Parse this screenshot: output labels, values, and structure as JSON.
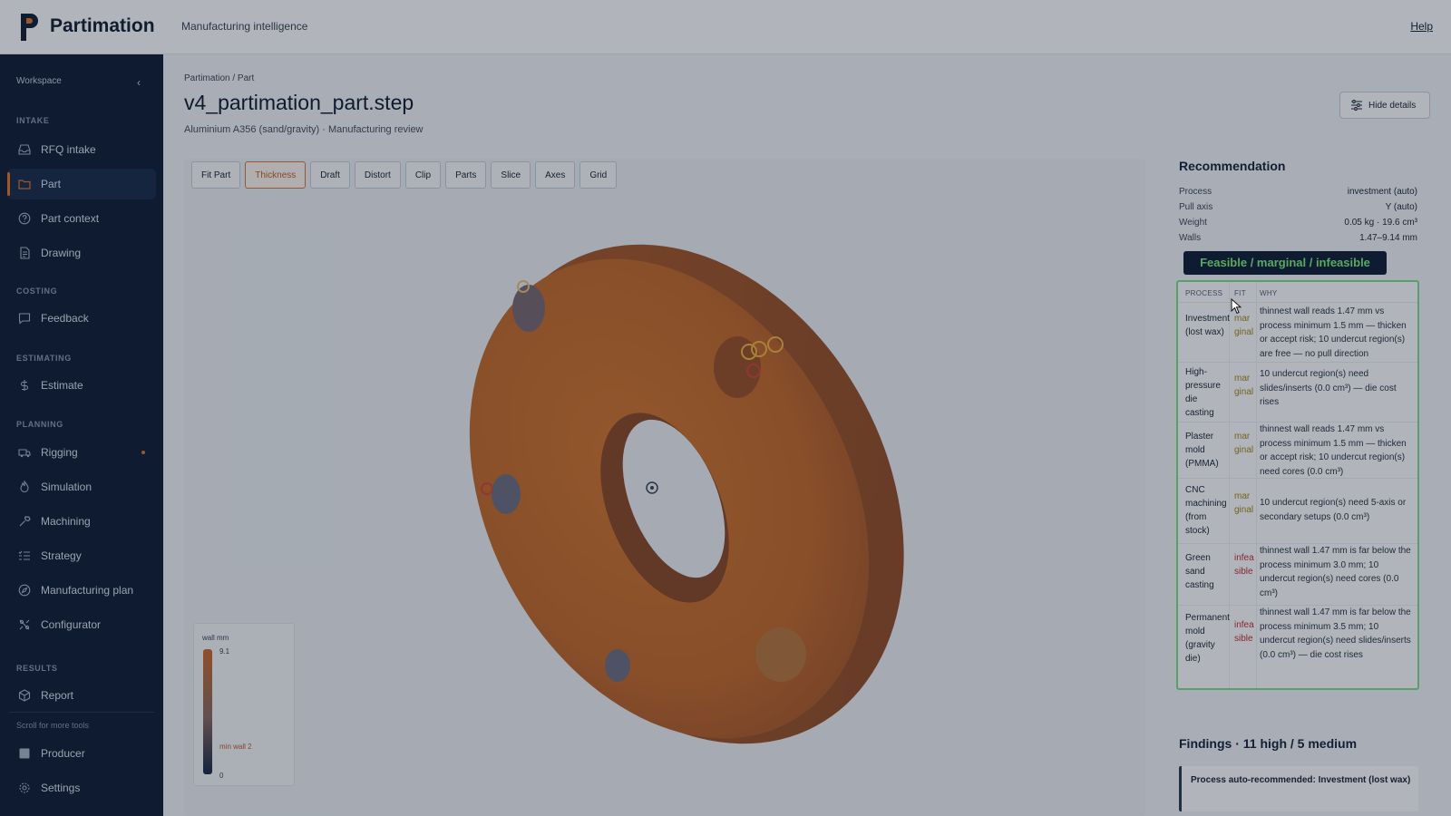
{
  "app": {
    "brand": "Partimation",
    "tagline": "Manufacturing intelligence",
    "help_label": "Help"
  },
  "sidebar": {
    "workspace_label": "Workspace",
    "sections": [
      {
        "label": "INTAKE"
      },
      {
        "label": "COSTING"
      },
      {
        "label": "ESTIMATING"
      },
      {
        "label": "PLANNING"
      },
      {
        "label": "RESULTS"
      }
    ],
    "items": [
      {
        "label": "RFQ intake",
        "icon": "inbox-icon"
      },
      {
        "label": "Part",
        "icon": "folder-icon",
        "active": true
      },
      {
        "label": "Part context",
        "icon": "question-circle-icon"
      },
      {
        "label": "Drawing",
        "icon": "document-icon"
      },
      {
        "label": "Feedback",
        "icon": "chat-icon"
      },
      {
        "label": "Estimate",
        "icon": "dollar-icon"
      },
      {
        "label": "Rigging",
        "icon": "truck-icon",
        "dot": true
      },
      {
        "label": "Simulation",
        "icon": "flame-icon"
      },
      {
        "label": "Machining",
        "icon": "wrench-icon"
      },
      {
        "label": "Strategy",
        "icon": "list-check-icon"
      },
      {
        "label": "Manufacturing plan",
        "icon": "compass-icon"
      },
      {
        "label": "Configurator",
        "icon": "sliders-icon"
      },
      {
        "label": "Report",
        "icon": "cube-icon"
      },
      {
        "label": "Producer",
        "icon": "square-icon"
      },
      {
        "label": "Settings",
        "icon": "gear-icon"
      }
    ],
    "scroll_hint": "Scroll for more tools"
  },
  "header": {
    "breadcrumb": "Partimation / Part",
    "title": "v4_partimation_part.step",
    "subtitle": "Aluminium A356 (sand/gravity) · Manufacturing review",
    "hide_details_label": "Hide details"
  },
  "toolbar": {
    "buttons": [
      {
        "label": "Fit Part"
      },
      {
        "label": "Thickness",
        "active": true
      },
      {
        "label": "Draft"
      },
      {
        "label": "Distort"
      },
      {
        "label": "Clip"
      },
      {
        "label": "Parts"
      },
      {
        "label": "Slice"
      },
      {
        "label": "Axes"
      },
      {
        "label": "Grid"
      }
    ]
  },
  "legend": {
    "title": "wall mm",
    "max": "9.1",
    "min_wall": "min wall 2",
    "zero": "0"
  },
  "recommendation": {
    "title": "Recommendation",
    "rows": [
      {
        "key": "Process",
        "value": "investment (auto)"
      },
      {
        "key": "Pull axis",
        "value": "Y (auto)"
      },
      {
        "key": "Weight",
        "value": "0.05 kg · 19.6 cm³"
      },
      {
        "key": "Walls",
        "value": "1.47–9.14 mm"
      }
    ],
    "callout": "Feasible / marginal / infeasible",
    "table_headers": {
      "process": "PROCESS",
      "fit": "FIT",
      "why": "WHY"
    },
    "processes": [
      {
        "name": "Investment (lost wax)",
        "fit": "marginal",
        "why": "thinnest wall reads 1.47 mm vs process minimum 1.5 mm — thicken or accept risk; 10 undercut region(s) are free — no pull direction"
      },
      {
        "name": "High-pressure die casting",
        "fit": "marginal",
        "why": "10 undercut region(s) need slides/inserts (0.0 cm³) — die cost rises"
      },
      {
        "name": "Plaster mold (PMMA)",
        "fit": "marginal",
        "why": "thinnest wall reads 1.47 mm vs process minimum 1.5 mm — thicken or accept risk; 10 undercut region(s) need cores (0.0 cm³)"
      },
      {
        "name": "CNC machining (from stock)",
        "fit": "marginal",
        "why": "10 undercut region(s) need 5-axis or secondary setups (0.0 cm³)"
      },
      {
        "name": "Green sand casting",
        "fit": "infeasible",
        "why": "thinnest wall 1.47 mm is far below the process minimum 3.0 mm; 10 undercut region(s) need cores (0.0 cm³)"
      },
      {
        "name": "Permanent mold (gravity die)",
        "fit": "infeasible",
        "why": "thinnest wall 1.47 mm is far below the process minimum 3.5 mm; 10 undercut region(s) need slides/inserts (0.0 cm³) — die cost rises"
      }
    ]
  },
  "findings": {
    "title": "Findings · 11 high / 5 medium",
    "first": "Process auto-recommended: Investment (lost wax)"
  },
  "colors": {
    "accent": "#e0762b",
    "sidebar_bg": "#0f1e36",
    "part_color": "#c96a2a",
    "marginal": "#a38a1c",
    "infeasible": "#c03131",
    "callout_text": "#7ef07c"
  }
}
